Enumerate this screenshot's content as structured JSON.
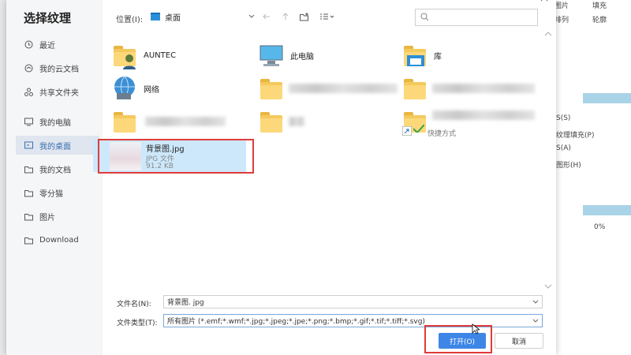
{
  "dialog": {
    "title": "选择纹理",
    "location_label": "位置(I):",
    "location_value": "桌面",
    "search_placeholder": ""
  },
  "sidebar": {
    "items": [
      {
        "label": "最近",
        "icon": "clock-icon"
      },
      {
        "label": "我的云文档",
        "icon": "cloud-icon"
      },
      {
        "label": "共享文件夹",
        "icon": "share-icon"
      },
      {
        "label": "我的电脑",
        "icon": "computer-icon"
      },
      {
        "label": "我的桌面",
        "icon": "desktop-icon",
        "active": true
      },
      {
        "label": "我的文档",
        "icon": "folder-icon"
      },
      {
        "label": "零分猫",
        "icon": "folder-icon"
      },
      {
        "label": "图片",
        "icon": "folder-icon"
      },
      {
        "label": "Download",
        "icon": "folder-icon"
      }
    ]
  },
  "files": {
    "auntec": "AUNTEC",
    "this_pc": "此电脑",
    "library": "库",
    "network": "网络",
    "shortcut_type": "快捷方式",
    "selected": {
      "name": "背景图.jpg",
      "type": "JPG 文件",
      "size": "91.2 KB"
    }
  },
  "footer": {
    "filename_label": "文件名(N):",
    "filename_value": "背景图. jpg",
    "filetype_label": "文件类型(T):",
    "filetype_value": "所有图片 (*.emf;*.wmf;*.jpg;*.jpeg;*.jpe;*.png;*.bmp;*.gif;*.tif;*.tiff;*.svg)",
    "open_label": "打开(O)",
    "cancel_label": "取消"
  },
  "background_app": {
    "picture_label": "图片",
    "fill_label": "填充",
    "arrange_label": "排列",
    "outline_label": "轮廓",
    "menu1": "S(S)",
    "menu2": "纹理填充(P)",
    "menu3": "S(A)",
    "menu4": "图形(H)",
    "percent": "0%"
  },
  "colors": {
    "accent": "#3d86e6",
    "highlight": "#e03b3b",
    "selected_bg": "#cde8fb"
  }
}
